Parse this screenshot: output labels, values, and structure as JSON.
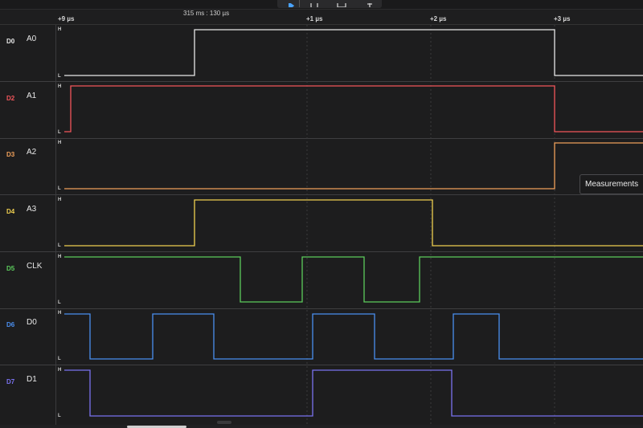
{
  "toolbar": {
    "play_icon": "play-icon",
    "loop_icon": "loop-icon",
    "trigger_icon": "trigger-icon",
    "probe_icon": "probe-icon"
  },
  "ruler": {
    "timestamp": "315 ms : 130 µs",
    "ticks": [
      "+9 µs",
      "+1 µs",
      "+2 µs",
      "+3 µs"
    ]
  },
  "level_labels": {
    "high": "H",
    "low": "L"
  },
  "channels": [
    {
      "id": "D0",
      "name": "A0",
      "color": "#e8e8e8"
    },
    {
      "id": "D2",
      "name": "A1",
      "color": "#f2555a"
    },
    {
      "id": "D3",
      "name": "A2",
      "color": "#f0a05a"
    },
    {
      "id": "D4",
      "name": "A3",
      "color": "#f0d050"
    },
    {
      "id": "D5",
      "name": "CLK",
      "color": "#5ccc5c"
    },
    {
      "id": "D6",
      "name": "D0",
      "color": "#4a8ff0"
    },
    {
      "id": "D7",
      "name": "D1",
      "color": "#7a72f0"
    }
  ],
  "measurements_tab": {
    "label": "Measurements"
  }
}
